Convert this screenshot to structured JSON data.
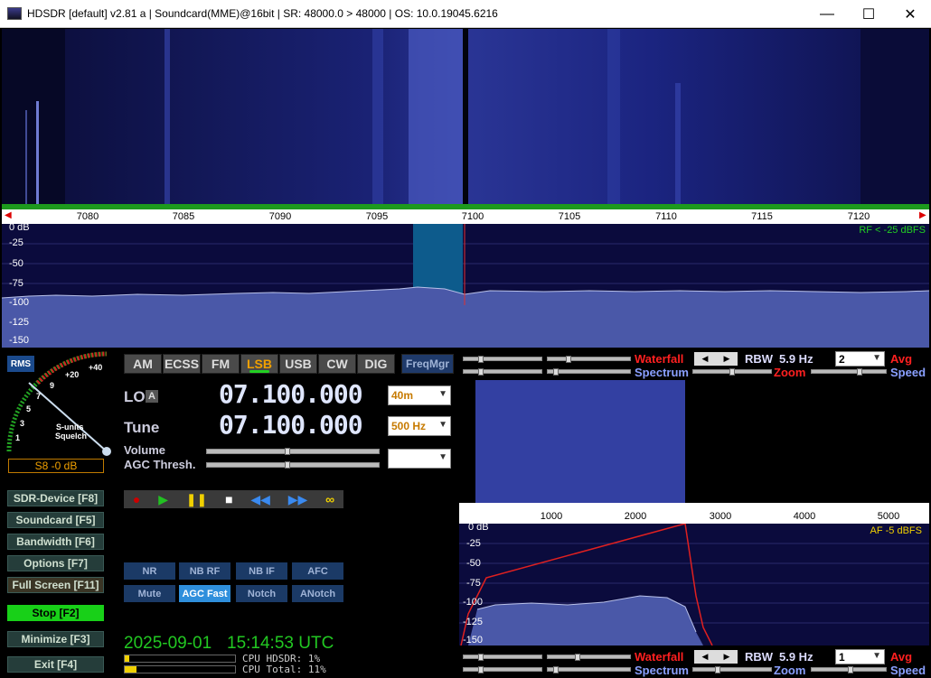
{
  "titlebar": {
    "title": "HDSDR  [default]  v2.81 a  |  Soundcard(MME)@16bit  |  SR: 48000.0 > 48000  |  OS: 10.0.19045.6216",
    "minimize": "—",
    "maximize": "☐",
    "close": "✕"
  },
  "main_scale": {
    "ticks": [
      "7080",
      "7085",
      "7090",
      "7095",
      "7100",
      "7105",
      "7110",
      "7115",
      "7120"
    ]
  },
  "main_spectrum": {
    "db_labels": [
      "0 dB",
      "-25",
      "-50",
      "-75",
      "-100",
      "-125",
      "-150"
    ],
    "rf_level": "RF < -25 dBFS"
  },
  "meter": {
    "rms_label": "RMS",
    "scale_labels": [
      "+40",
      "+20",
      "9",
      "7",
      "5",
      "3",
      "1"
    ],
    "smeter_caption_1": "S-units",
    "smeter_caption_2": "Squelch",
    "reading": "S8 -0 dB"
  },
  "modes": [
    "AM",
    "ECSS",
    "FM",
    "LSB",
    "USB",
    "CW",
    "DIG"
  ],
  "active_mode": "LSB",
  "freqmgr": "FreqMgr",
  "lo": {
    "label": "LO",
    "vfo": "A",
    "frequency": "07.100.000",
    "band": "40m"
  },
  "tune": {
    "label": "Tune",
    "frequency": "07.100.000",
    "bandwidth": "500 Hz"
  },
  "volume_label": "Volume",
  "agc_label": "AGC Thresh.",
  "agc_select": "",
  "sidebar": [
    {
      "label": "SDR-Device [F8]"
    },
    {
      "label": "Soundcard  [F5]"
    },
    {
      "label": "Bandwidth  [F6]"
    },
    {
      "label": "Options   [F7]"
    },
    {
      "label": "Full Screen  [F11]"
    },
    {
      "label": "Stop      [F2]"
    },
    {
      "label": "Minimize  [F3]"
    },
    {
      "label": "Exit       [F4]"
    }
  ],
  "dsp_row1": [
    "NR",
    "NB RF",
    "NB IF",
    "AFC"
  ],
  "dsp_row2": [
    "Mute",
    "AGC Fast",
    "Notch",
    "ANotch"
  ],
  "active_dsp": "AGC Fast",
  "clock": {
    "date": "2025-09-01",
    "time": "15:14:53 UTC"
  },
  "cpu": {
    "hdsdr": "CPU HDSDR:  1%",
    "total": "CPU Total: 11%",
    "total_fraction": 0.11,
    "hdsdr_fraction": 0.01
  },
  "wf_controls_top": {
    "waterfall": "Waterfall",
    "spectrum": "Spectrum",
    "rbw_label": "RBW",
    "rbw_value": "5.9 Hz",
    "avg_select": "2",
    "avg": "Avg",
    "zoom": "Zoom",
    "speed": "Speed"
  },
  "wf_controls_bottom": {
    "waterfall": "Waterfall",
    "spectrum": "Spectrum",
    "rbw_label": "RBW",
    "rbw_value": "5.9 Hz",
    "avg_select": "1",
    "avg": "Avg",
    "zoom": "Zoom",
    "speed": "Speed"
  },
  "af_scale": {
    "ticks": [
      "1000",
      "2000",
      "3000",
      "4000",
      "5000"
    ]
  },
  "af_spectrum": {
    "db_labels": [
      "0 dB",
      "-25",
      "-50",
      "-75",
      "-100",
      "-125",
      "-150"
    ],
    "af_level": "AF  -5 dBFS"
  },
  "colors": {
    "waterfall_text": "#ff2020",
    "rbw_text": "#ddddff",
    "avg_text": "#ff2020",
    "accent_orange": "#f0a000",
    "clock_green": "#22c822"
  }
}
